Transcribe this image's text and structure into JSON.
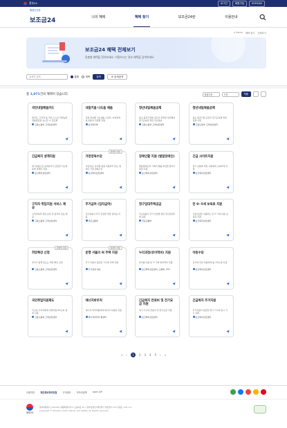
{
  "topbar": {
    "gov_label": "정부24",
    "links": [
      "로그인",
      "회원가입",
      "KOREAN"
    ]
  },
  "header": {
    "logo_sub": "행정안전부",
    "logo_main": "보조금24",
    "nav": [
      "나의 혜택",
      "혜택 찾기",
      "보조금24란",
      "이용안내"
    ]
  },
  "breadcrumb": [
    "Home",
    "혜택 찾기",
    "전체보기"
  ],
  "banner": {
    "title": "보조금24 혜택 전체보기",
    "desc": "맞춤형 혜택을 찾아보세요. 이용하시는 정부 혜택을 검색하세요."
  },
  "search": {
    "placeholder": "검색어 입력",
    "radios": [
      "통합",
      "제목"
    ],
    "search_btn": "검색",
    "detail_btn": "상세검색"
  },
  "results": {
    "count_prefix": "총 ",
    "count": "1,071",
    "count_suffix": "건의 혜택이 있습니다.",
    "sort1": "정렬기준",
    "sort2": "기관",
    "apply_btn": "적용"
  },
  "cards": [
    {
      "title": "국민내일배움카드",
      "desc": "재직자, 구직자 등 국민 스스로 직업능력개발훈련을 실시할 수 있도록",
      "org": "고용노동부 고객상담센터",
      "badge": ""
    },
    {
      "title": "내일키움 나도움 채움",
      "desc": "지원 대상별 기초생활 수급자, 차상위계층 아동의 자립을 지원",
      "org": "보건복지부",
      "badge": ""
    },
    {
      "title": "청년내일채움공제",
      "desc": "중소·중견기업에 정규직 취업한 청년들의 장기근속을 위한 자산형성",
      "org": "고용노동부 고객상담센터",
      "badge": ""
    },
    {
      "title": "청년내일채움공제",
      "desc": "중소·중견기업 근로자 장기근속을 위한 공제 사업",
      "org": "고용노동부 고객상담센터",
      "badge": ""
    },
    {
      "title": "긴급복지 생계지원",
      "desc": "위기상황으로 생계유지가 곤란한 저소득층에 생계비 지원",
      "org": "보건복지상담센터",
      "badge": ""
    },
    {
      "title": "가정양육수당",
      "desc": "어린이집, 유치원 등을 이용하지 않는 영유아 가정 양육수당",
      "org": "보건복지상담센터",
      "badge": "온라인 신청"
    },
    {
      "title": "장애인활 지원 (발달장애인)",
      "desc": "발달장애인과 가족의 돌봄 부담을 줄이기 위한 지원",
      "org": "보건복지상담센터",
      "badge": ""
    },
    {
      "title": "긴급 사이트지원",
      "desc": "위기 상황에 처한 사람에게 신속하게 지원",
      "org": "보건복지상담센터",
      "badge": ""
    },
    {
      "title": "구직자 취업지원 서비스 제공",
      "desc": "구직자에게 취업 상담 및 일자리 정보 제공",
      "org": "고용노동부 고객상담센터",
      "badge": ""
    },
    {
      "title": "주거급여 (임차급여)",
      "desc": "저소득층의 주거 안정을 위한 임차료 지원",
      "org": "국토교통부",
      "badge": ""
    },
    {
      "title": "영구임대주택공급",
      "desc": "저소득층의 주거 안정을 위한 영구임대주택 공급",
      "org": "국토교통부",
      "badge": ""
    },
    {
      "title": "만 0~5세 보육료 지원",
      "desc": "어린이집을 이용하는 만 0~5세 아동 보육료 지원",
      "org": "보건복지상담센터",
      "badge": ""
    },
    {
      "title": "희망특강 신청",
      "desc": "우리가 함께 만드는 희망 특강 신청",
      "org": "고용노동부 고객상담센터",
      "badge": "온라인 신청"
    },
    {
      "title": "운행 서울의 써 주택 지원",
      "desc": "주거 지원이 필요한 가구에 주택 지원",
      "org": "주거급여 대상",
      "badge": "온라인 신청"
    },
    {
      "title": "누리과정(유아학비) 지원",
      "desc": "유치원 이용 만 3~5세 유아학비 지원",
      "org": "보건복지상담센터, 교육부, 001",
      "badge": ""
    },
    {
      "title": "아동수당",
      "desc": "만 8세 미만 아동에게 월 10만 원 지급",
      "org": "보건복지상담센터",
      "badge": ""
    },
    {
      "title": "국민취업지원제도",
      "desc": "저소득 구직자에게 취업지원서비스와 생계 지원",
      "org": "고용노동부 고객상담센터",
      "badge": ""
    },
    {
      "title": "에너지바우처",
      "desc": "에너지 취약계층에게 에너지 이용권 지원",
      "org": "에너지바우처 콜센터",
      "badge": ""
    },
    {
      "title": "긴급복지 연료비 및 전기요금 지원",
      "desc": "위기 가구에 연료비 및 전기요금 지원",
      "org": "보건복지상담센터",
      "badge": ""
    },
    {
      "title": "긴급복지 주거지원",
      "desc": "주거지원이 필요한 위기 가구에 임시 거소 지원",
      "org": "보건복지상담센터",
      "badge": ""
    }
  ],
  "pager": [
    "1",
    "2",
    "3",
    "4",
    "5"
  ],
  "footer": {
    "links": [
      "이용약관",
      "개인정보처리방침",
      "고객센터",
      "저작권정책",
      "open API"
    ],
    "gov": "정부24",
    "info": "정부세종청사 (30128) 세종특별자치시 도움6로 42 | 정부민원안내콜센터 국번없이 110 (유료) 110-1-0",
    "copyright": "Copyright © Ministry of the Interior and Safety. All Rights reserved."
  },
  "sns_colors": [
    "#3aa345",
    "#1877f2",
    "#e74c3c",
    "#f7b500",
    "#e60023"
  ]
}
